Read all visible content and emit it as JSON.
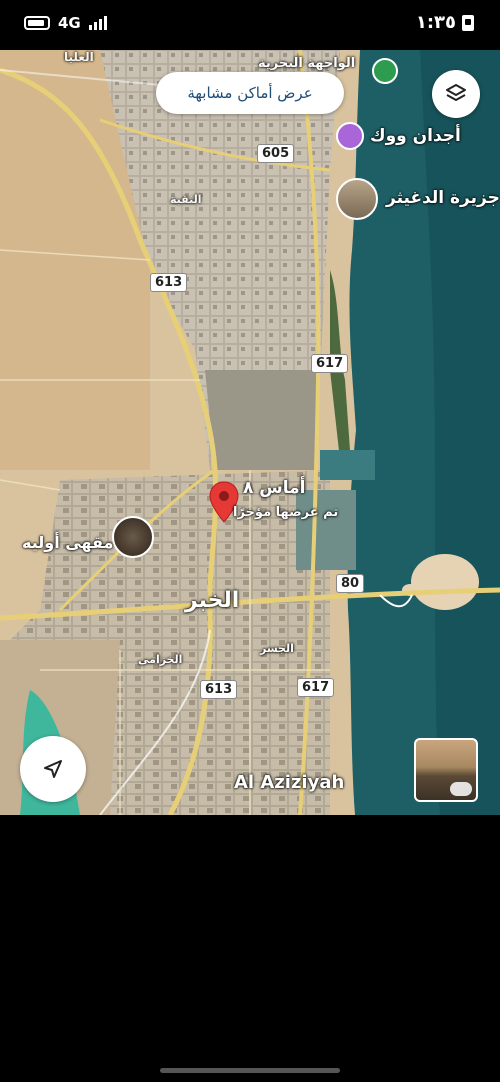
{
  "status_bar": {
    "network": "4G",
    "time": "١:٣٥"
  },
  "map": {
    "search_similar_button": "عرض أماكن مشابهة",
    "places": {
      "ajdan_walk": "أجدان ووك",
      "dughaither_island": "جزيرة الدغيثر",
      "amas8": "أماس ٨",
      "amas8_sub": "تم عرضها مؤخرًا",
      "oleya_cafe": "مقهى أوليه",
      "khobar": "الخبر",
      "aziziyah": "Al Aziziyah",
      "olaya_district": "العليا",
      "waterfront": "الواجهة البحرية",
      "thuqbah": "الثقبة",
      "khuzama": "الخزامى",
      "jisr": "الجسر"
    },
    "routes": {
      "r605": "605",
      "r613a": "613",
      "r617a": "617",
      "r80": "80",
      "r613b": "613",
      "r617b": "617"
    },
    "icons": [
      "layers-icon",
      "navigation-arrow-icon",
      "tree-icon",
      "camera-icon",
      "map-pin-icon",
      "rotate-360-icon"
    ],
    "colors": {
      "water": "#1e5f66",
      "desert": "#d8c2a0",
      "pin": "#e53935"
    }
  }
}
